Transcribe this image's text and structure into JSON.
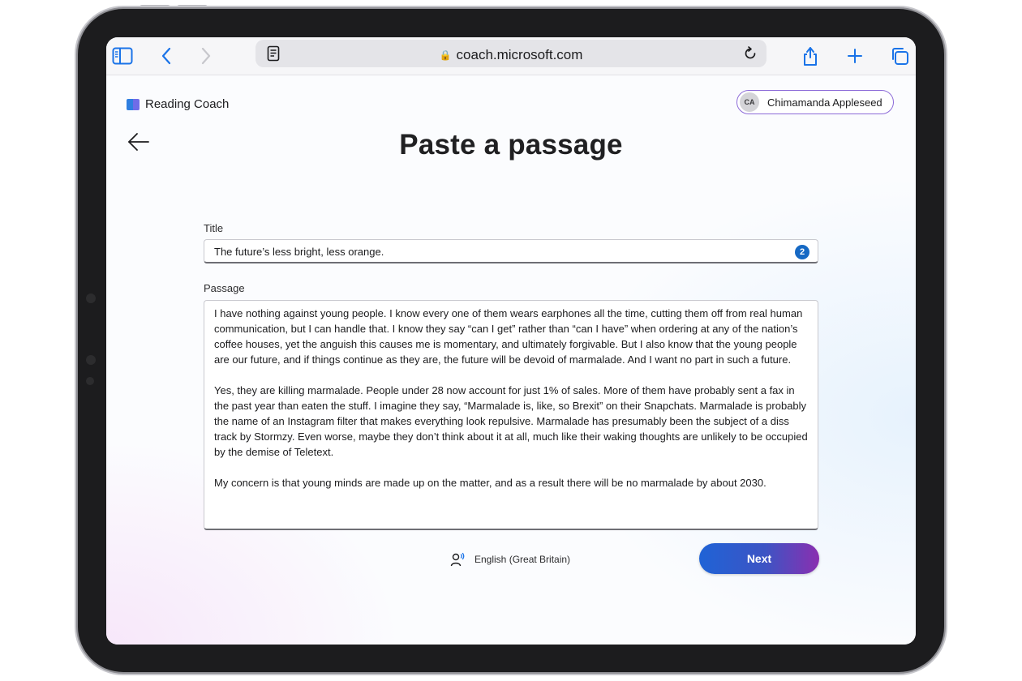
{
  "browser": {
    "url": "coach.microsoft.com"
  },
  "app": {
    "name": "Reading Coach"
  },
  "user": {
    "initials": "CA",
    "name": "Chimamanda Appleseed"
  },
  "page": {
    "title": "Paste a passage"
  },
  "form": {
    "title_label": "Title",
    "title_value": "The future’s less bright, less orange.",
    "title_count": "2",
    "passage_label": "Passage",
    "passage_paragraphs": [
      "I have nothing against young people. I know every one of them wears earphones all the time, cutting them off from real human communication, but I can handle that. I know they say “can I get” rather than “can I have” when ordering at any of the nation’s coffee houses, yet the anguish this causes me is momentary, and ultimately forgivable. But I also know that the young people are our future, and if things continue as they are, the future will be devoid of marmalade. And I want no part in such a future.",
      "Yes, they are killing marmalade. People under 28 now account for just 1% of sales. More of them have probably sent a fax in the past year than eaten the stuff. I imagine they say, “Marmalade is, like, so Brexit” on their Snapchats. Marmalade is probably the name of an Instagram filter that makes everything look repulsive. Marmalade has presumably been the subject of a diss track by Stormzy. Even worse, maybe they don’t think about it at all, much like their waking thoughts are unlikely to be occupied by the demise of Teletext.",
      "My concern is that young minds are made up on the matter, and as a result there will be no marmalade by about 2030."
    ],
    "language": "English (Great Britain)",
    "next_label": "Next"
  }
}
